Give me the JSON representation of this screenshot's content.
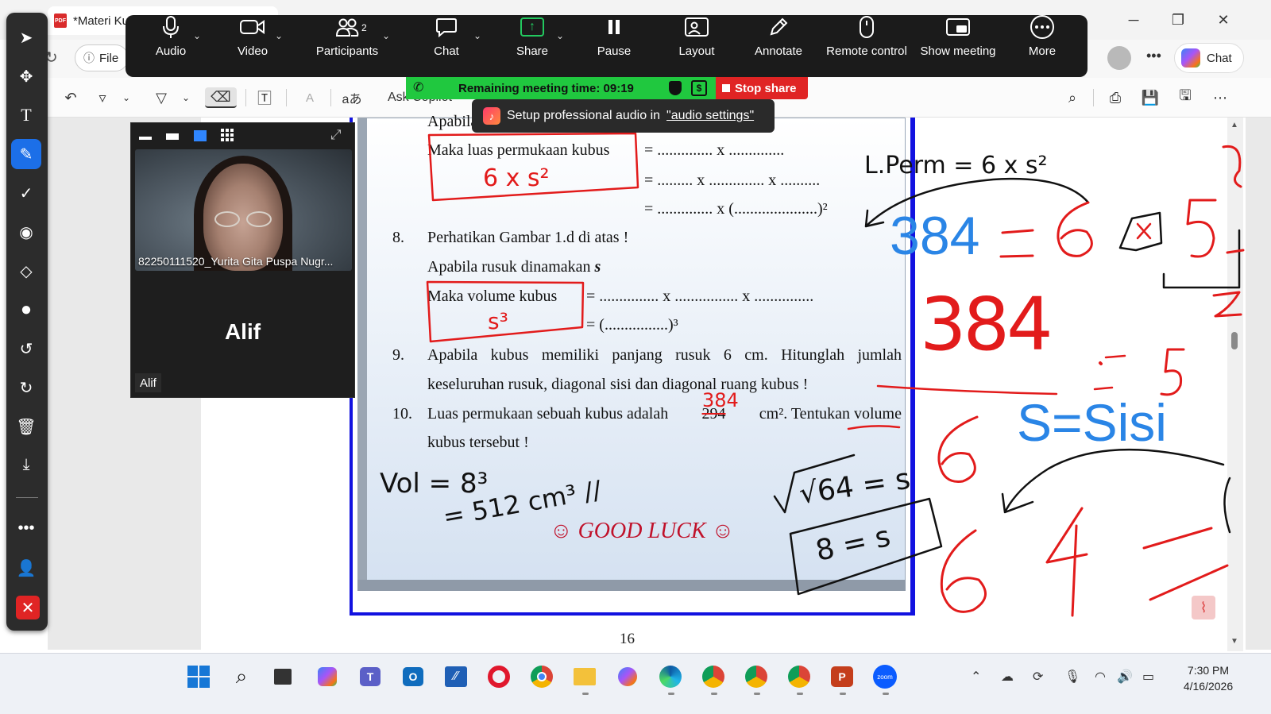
{
  "window": {
    "tab_title": "*Materi Ku",
    "file_button": "File",
    "chat_button": "Chat",
    "minimize": "─",
    "restore": "❐",
    "close": "✕",
    "toolbar_copilot": "Ask Copilot",
    "colors": {
      "frame_blue": "#1212e0",
      "zoom_green": "#20c83f",
      "stop_red": "#e02424"
    }
  },
  "zoom_toolbar": {
    "items": [
      {
        "label": "Audio",
        "icon": "microphone-icon"
      },
      {
        "label": "Video",
        "icon": "camera-icon"
      },
      {
        "label": "Participants",
        "icon": "participants-icon",
        "count": "2"
      },
      {
        "label": "Chat",
        "icon": "chat-bubble-icon"
      },
      {
        "label": "Share",
        "icon": "share-screen-icon"
      },
      {
        "label": "Pause",
        "icon": "pause-icon"
      },
      {
        "label": "Layout",
        "icon": "layout-icon"
      },
      {
        "label": "Annotate",
        "icon": "pen-icon"
      },
      {
        "label": "Remote control",
        "icon": "mouse-icon"
      },
      {
        "label": "Show meeting",
        "icon": "show-meeting-icon"
      },
      {
        "label": "More",
        "icon": "more-icon"
      }
    ]
  },
  "meeting_bar": {
    "remaining": "Remaining meeting time: 09:19",
    "stop_share": "Stop share",
    "toast_prefix": "Setup professional audio in",
    "toast_link": "\"audio settings\""
  },
  "video_panel": {
    "participant_name": "82250111520_Yurita Gita Puspa Nugr...",
    "self_name": "Alif",
    "self_tag": "Alif"
  },
  "document": {
    "page_number": "16",
    "rows": [
      {
        "text": "Apabila rusuk dinamakan",
        "var": "s"
      },
      {
        "text": "Maka luas permukaan kubus"
      },
      {
        "text": "=    .............. x .............."
      },
      {
        "text": "=    ......... x .............. x .........."
      },
      {
        "text": "=    .............. x (.....................)²"
      },
      {
        "num": "8.",
        "text": "Perhatikan Gambar 1.d di atas !"
      },
      {
        "text": "Apabila rusuk dinamakan",
        "var": "s"
      },
      {
        "text": "Maka volume kubus"
      },
      {
        "text": "=  ............... x ................ x ..............."
      },
      {
        "text": "=  (................)³"
      },
      {
        "num": "9.",
        "text": "Apabila kubus memiliki panjang rusuk 6 cm. Hitunglah jumlah"
      },
      {
        "text": "keseluruhan rusuk, diagonal sisi dan diagonal ruang kubus !"
      },
      {
        "num": "10.",
        "text": "Luas permukaan sebuah kubus adalah",
        "struck": "294",
        "after": "cm². Tentukan volume"
      },
      {
        "text": "kubus tersebut !"
      }
    ],
    "good_luck": "☺ GOOD LUCK ☺"
  },
  "ink": {
    "blue_384": "384",
    "blue_sisi": "S=Sisi",
    "red_area": "6 x s²",
    "red_volume": "s³",
    "red_384": "384",
    "black_lperm": "L.Perm = 6 x s²",
    "black_vol_1": "Vol = 8³",
    "black_vol_2": "= 512 cm³ //",
    "black_sqrt": "√64 = s",
    "black_8s": "8 = s"
  },
  "taskbar": {
    "time": "7:30 PM",
    "date": "4/16/2026"
  }
}
